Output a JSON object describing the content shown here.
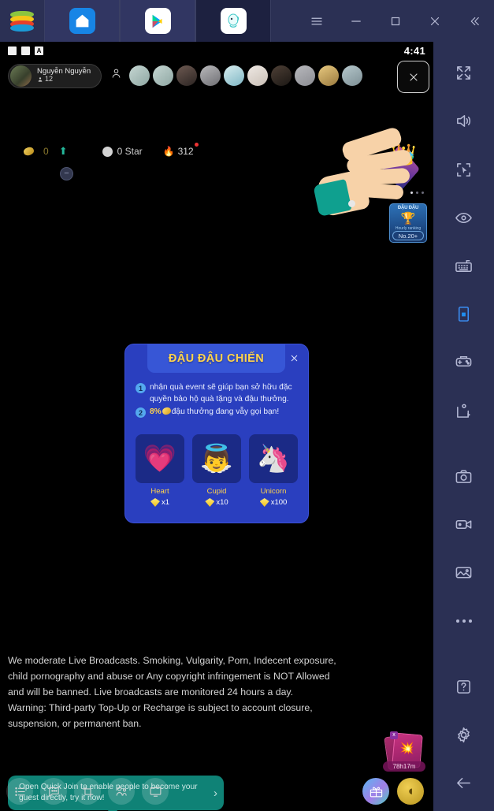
{
  "emulator": {
    "tabs": [
      {
        "name": "bluestacks-logo",
        "icon": "bluestacks-logo"
      },
      {
        "name": "home",
        "icon": "home-icon",
        "active": false
      },
      {
        "name": "play-store",
        "icon": "google-play-icon",
        "active": false
      },
      {
        "name": "game-app",
        "icon": "app-icon",
        "active": true
      }
    ],
    "window_controls": [
      {
        "name": "menu-button",
        "icon": "hamburger-icon"
      },
      {
        "name": "minimize-button",
        "icon": "minimize-icon"
      },
      {
        "name": "maximize-button",
        "icon": "maximize-icon"
      },
      {
        "name": "close-button",
        "icon": "close-icon"
      },
      {
        "name": "collapse-sidebar-button",
        "icon": "chevron-double-left-icon"
      }
    ]
  },
  "status_bar": {
    "time": "4:41",
    "a_badge": "A"
  },
  "live": {
    "host": {
      "name": "Nguyễn Nguyễn",
      "viewer_count": "12"
    },
    "stats": {
      "coins": "0",
      "stars": "0 Star",
      "hot": "312"
    },
    "viewer_avatars_count": 10,
    "close_label": "✕"
  },
  "rank_card": {
    "title": "ĐẬU ĐẬU",
    "subtitle": "Hourly ranking",
    "rank": "No.20+"
  },
  "modal": {
    "title": "ĐẬU ĐẬU CHIẾN",
    "close_label": "✕",
    "bullets": [
      {
        "num": "1",
        "text": "nhận quà event sẽ giúp bạn sở hữu đặc quyền bảo hộ quà tặng và đậu thưởng."
      },
      {
        "num": "2",
        "prefix": "8%",
        "text": "đậu thưởng đang vẫy gọi bạn!"
      }
    ],
    "gifts": [
      {
        "name": "Heart",
        "cost": "x1",
        "emoji": "💗"
      },
      {
        "name": "Cupid",
        "cost": "x10",
        "emoji": "👼"
      },
      {
        "name": "Unicorn",
        "cost": "x100",
        "emoji": "🦄"
      }
    ]
  },
  "notice": {
    "line1": "We moderate Live Broadcasts. Smoking, Vulgarity, Porn, Indecent exposure,",
    "line2": "child pornography and abuse or Any copyright infringement is NOT Allowed",
    "line3": "and will be banned. Live broadcasts are monitored 24 hours a day.",
    "line4": "Warning: Third-party Top-Up or Recharge is subject to account closure,",
    "line5": "suspension, or permanent ban."
  },
  "quick_join": {
    "text": "Open Quick Join to enable people to become your guest directly, try it now!",
    "arrow": "›"
  },
  "bottom_nav": [
    {
      "name": "list-icon"
    },
    {
      "name": "chat-icon"
    },
    {
      "name": "crop-icon"
    },
    {
      "name": "guest-icon"
    },
    {
      "name": "screen-icon"
    }
  ],
  "bottom_right": {
    "gift_button": "gift-icon",
    "coin_button": "coin-icon",
    "reward_timer": "78h17m",
    "reward_count": "x"
  },
  "sidebar": [
    {
      "name": "fullscreen-icon"
    },
    {
      "name": "volume-icon"
    },
    {
      "name": "macro-cursor-icon"
    },
    {
      "name": "eye-icon"
    },
    {
      "name": "keyboard-icon"
    },
    {
      "name": "phone-rotate-icon"
    },
    {
      "name": "gamepad-icon"
    },
    {
      "name": "script-play-icon"
    },
    {
      "name": "screenshot-camera-icon"
    },
    {
      "name": "record-video-icon"
    },
    {
      "name": "media-gallery-icon"
    },
    {
      "name": "more-options-icon"
    },
    {
      "name": "help-icon"
    },
    {
      "name": "settings-gear-icon"
    },
    {
      "name": "back-arrow-icon"
    }
  ],
  "colors": {
    "chrome": "#2b3054",
    "accent_blue": "#2a3fbf",
    "gold": "#ffd34d",
    "teal": "#0f8276"
  }
}
